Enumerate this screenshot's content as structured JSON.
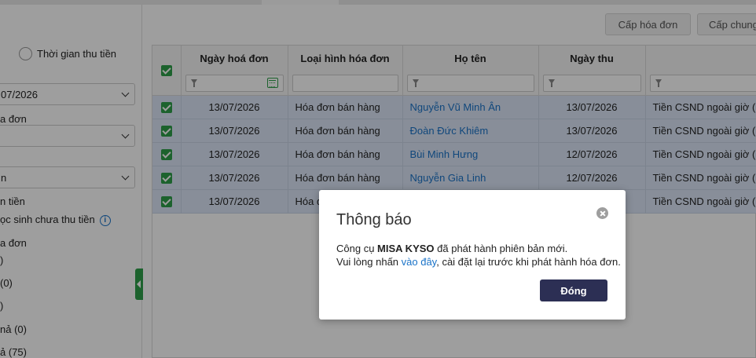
{
  "left": {
    "radio_label": "Thời gian thu tiền",
    "date_value": "07/2026",
    "label_invoice": "a đơn",
    "select2_value": "",
    "select3_value": "n",
    "label_money": "n tiền",
    "label_unpaid": "ọc sinh chưa thu tiền",
    "label_invoice2": "a đơn",
    "count_a": ")",
    "count_b": " (0)",
    "count_c": ")",
    "count_d": "nả (0)",
    "count_e": "ả (75)"
  },
  "toolbar": {
    "issue_invoice": "Cấp hóa đơn",
    "issue_common": "Cấp chung"
  },
  "table": {
    "headers": {
      "invoice_date": "Ngày hoá đơn",
      "invoice_type": "Loại hình hóa đơn",
      "full_name": "Họ tên",
      "collect_date": "Ngày thu",
      "extra": ""
    },
    "rows": [
      {
        "invoice_date": "13/07/2026",
        "invoice_type": "Hóa đơn bán hàng",
        "name": "Nguyễn Vũ Minh Ân",
        "collect_date": "13/07/2026",
        "content": "Tiền CSND ngoài giờ (n"
      },
      {
        "invoice_date": "13/07/2026",
        "invoice_type": "Hóa đơn bán hàng",
        "name": "Đoàn Đức Khiêm",
        "collect_date": "13/07/2026",
        "content": "Tiền CSND ngoài giờ (n"
      },
      {
        "invoice_date": "13/07/2026",
        "invoice_type": "Hóa đơn bán hàng",
        "name": "Bùi Minh Hưng",
        "collect_date": "12/07/2026",
        "content": "Tiền CSND ngoài giờ (n"
      },
      {
        "invoice_date": "13/07/2026",
        "invoice_type": "Hóa đơn bán hàng",
        "name": "Nguyễn Gia Linh",
        "collect_date": "12/07/2026",
        "content": "Tiền CSND ngoài giờ (n"
      },
      {
        "invoice_date": "13/07/2026",
        "invoice_type": "Hóa đ",
        "name": "",
        "collect_date": "",
        "content": "Tiền CSND ngoài giờ (n"
      }
    ]
  },
  "modal": {
    "title": "Thông báo",
    "line1_prefix": "Công cụ ",
    "line1_bold": "MISA KYSO",
    "line1_suffix": " đã phát hành phiên bản mới.",
    "line2_prefix": "Vui lòng nhấn ",
    "line2_link": "vào đây",
    "line2_suffix": ", cài đặt lại trước khi phát hành hóa đơn.",
    "close_button": "Đóng"
  },
  "colors": {
    "accent_green": "#2e9e4a",
    "link_blue": "#1a73c8",
    "button_dark": "#2c2f54",
    "selected_row": "#dce6f7"
  }
}
